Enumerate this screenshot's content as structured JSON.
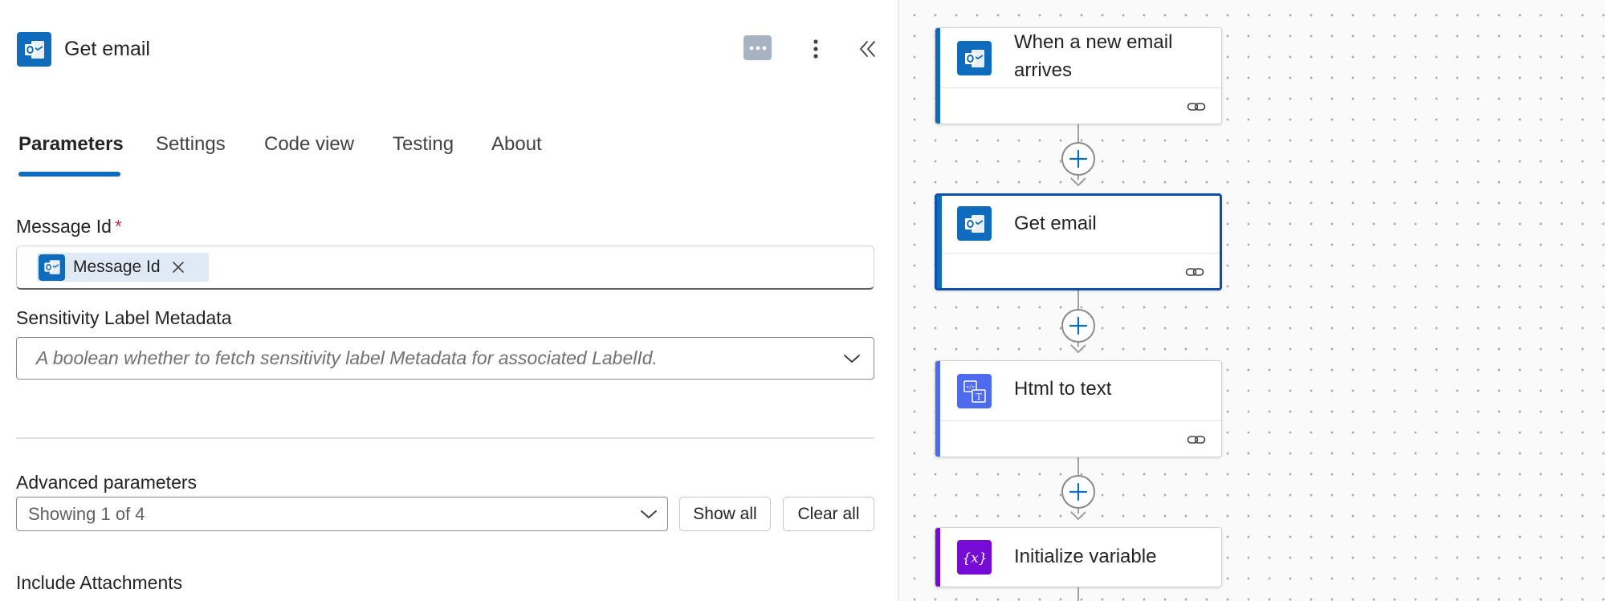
{
  "panel": {
    "title": "Get email",
    "tabs": [
      {
        "label": "Parameters",
        "active": true
      },
      {
        "label": "Settings",
        "active": false
      },
      {
        "label": "Code view",
        "active": false
      },
      {
        "label": "Testing",
        "active": false
      },
      {
        "label": "About",
        "active": false
      }
    ],
    "message_id": {
      "label": "Message Id",
      "required_marker": "*",
      "token_label": "Message Id"
    },
    "sensitivity": {
      "label": "Sensitivity Label Metadata",
      "placeholder": "A boolean whether to fetch sensitivity label Metadata for associated LabelId."
    },
    "advanced": {
      "label": "Advanced parameters",
      "selected": "Showing 1 of 4",
      "show_all": "Show all",
      "clear_all": "Clear all"
    },
    "include_attachments_label": "Include Attachments"
  },
  "canvas": {
    "nodes": [
      {
        "title": "When a new email arrives",
        "icon": "outlook-icon",
        "accent": "#0f6cbd",
        "selected": false
      },
      {
        "title": "Get email",
        "icon": "outlook-icon",
        "accent": "#0f6cbd",
        "selected": true
      },
      {
        "title": "Html to text",
        "icon": "html-to-text-icon",
        "accent": "#4f6bed",
        "selected": false
      },
      {
        "title": "Initialize variable",
        "icon": "variable-icon",
        "accent": "#770bd6",
        "selected": false
      }
    ]
  },
  "colors": {
    "outlook_blue": "#0f6cbd",
    "html_blue": "#4f6bed",
    "variable_purple": "#770bd6",
    "tab_underline": "#0f6cbd",
    "required": "#c4314b"
  }
}
